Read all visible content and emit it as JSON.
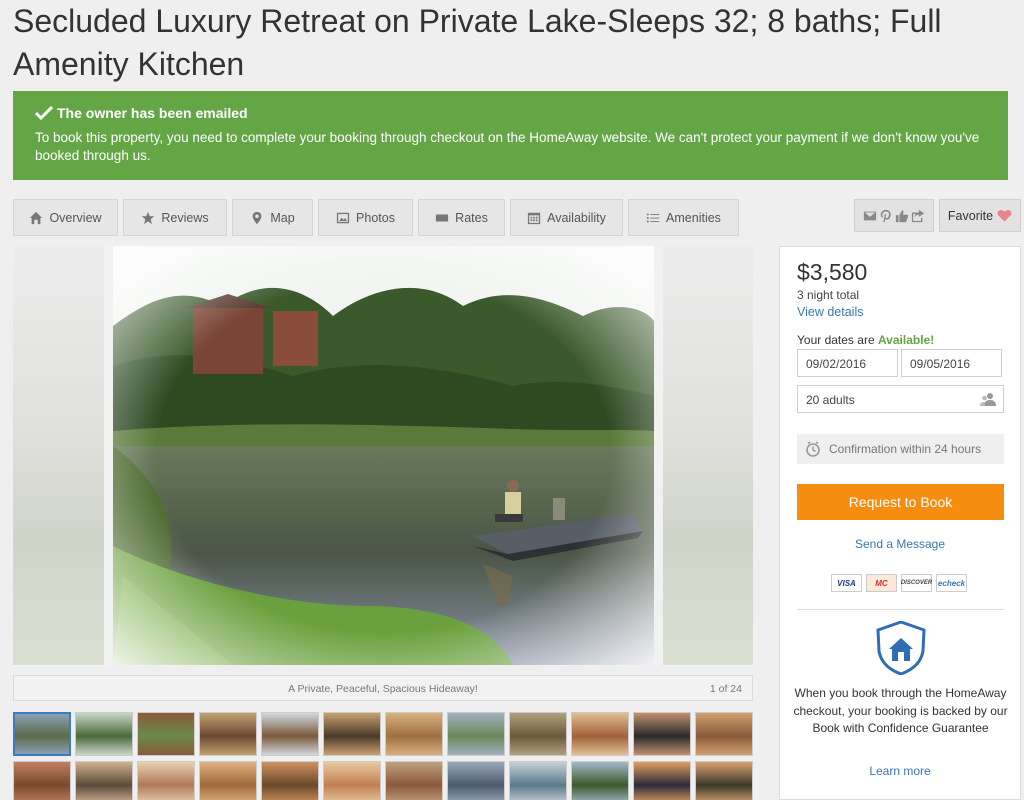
{
  "listing": {
    "title": "Secluded Luxury Retreat on Private Lake-Sleeps 32; 8 baths; Full Amenity Kitchen"
  },
  "alert": {
    "heading": "The owner has been emailed",
    "body": "To book this property, you need to complete your booking through checkout on the HomeAway website. We can't protect your payment if we don't know you've booked through us.",
    "color": "#64a545"
  },
  "tabs": [
    {
      "label": "Overview",
      "icon": "home-icon"
    },
    {
      "label": "Reviews",
      "icon": "star-icon"
    },
    {
      "label": "Map",
      "icon": "map-pin-icon"
    },
    {
      "label": "Photos",
      "icon": "image-icon"
    },
    {
      "label": "Rates",
      "icon": "rates-icon"
    },
    {
      "label": "Availability",
      "icon": "calendar-icon"
    },
    {
      "label": "Amenities",
      "icon": "list-icon"
    }
  ],
  "share": {
    "icons": [
      "email-icon",
      "pinterest-icon",
      "thumbs-up-icon",
      "share-icon"
    ]
  },
  "favorite": {
    "label": "Favorite",
    "icon": "heart-icon"
  },
  "gallery": {
    "caption": "A Private, Peaceful, Spacious Hideaway!",
    "counter": "1 of 24",
    "thumbnail_count": 24,
    "active_index": 0
  },
  "booking": {
    "price": "$3,580",
    "night_total": "3 night total",
    "view_details": "View details",
    "dates_prefix": "Your dates are ",
    "dates_status": "Available!",
    "check_in": "09/02/2016",
    "check_out": "09/05/2016",
    "guests": "20 adults",
    "confirmation": "Confirmation within 24 hours",
    "request_button": "Request to Book",
    "send_message": "Send a Message",
    "cards": [
      "VISA",
      "MC",
      "DISCOVER",
      "echeck"
    ],
    "guarantee": "When you book through the HomeAway checkout, your booking is backed by our Book with Confidence Guarantee",
    "learn_more": "Learn more",
    "accent": "#f58d10",
    "link_color": "#3a76b8"
  }
}
